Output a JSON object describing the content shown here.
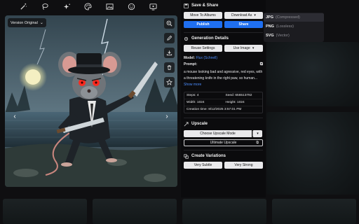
{
  "toolbar": {
    "icons": [
      "magic-wand-icon",
      "lasso-icon",
      "sparkles-icon",
      "palette-icon",
      "image-icon",
      "emoji-icon",
      "monitor-icon"
    ]
  },
  "viewer": {
    "version_label": "Version Original",
    "side_tools": [
      "zoom-icon",
      "edit-icon",
      "download-icon",
      "trash-icon",
      "star-icon"
    ]
  },
  "save_share": {
    "title": "Save & Share",
    "move_label": "Move To Albums",
    "download_label": "Download As",
    "publish_label": "Publish",
    "share_label": "Share"
  },
  "formats": [
    {
      "name": "JPG",
      "desc": "(Compressed)"
    },
    {
      "name": "PNG",
      "desc": "(Lossless)"
    },
    {
      "name": "SVG",
      "desc": "(Vector)"
    }
  ],
  "generation": {
    "title": "Generation Details",
    "reuse_label": "Reuse Settings",
    "use_image_label": "Use Image",
    "model_key": "Model:",
    "model_value": "Flux (Schnell)",
    "prompt_key": "Prompt:",
    "prompt_text": "a mouse looking bad and agressive, red eyes, with a threatening knife in the right paw, so human...",
    "show_more": "Show more",
    "steps": "Steps: 4",
    "seed": "Seed: 656513792",
    "width": "Width: 1024",
    "height": "Height: 1024",
    "creation": "Creation time: 8/12/2025 3:57:01 PM"
  },
  "upscale": {
    "title": "Upscale",
    "mode_label": "Choose Upscale Mode",
    "ultimate_label": "Ultimate Upscale"
  },
  "variations": {
    "title": "Create Variations",
    "subtle_label": "Very Subtle",
    "strong_label": "Very Strong"
  },
  "colors": {
    "accent": "#1f6ff0",
    "link": "#4c8dff",
    "panel_bg": "#0b0b0d"
  }
}
